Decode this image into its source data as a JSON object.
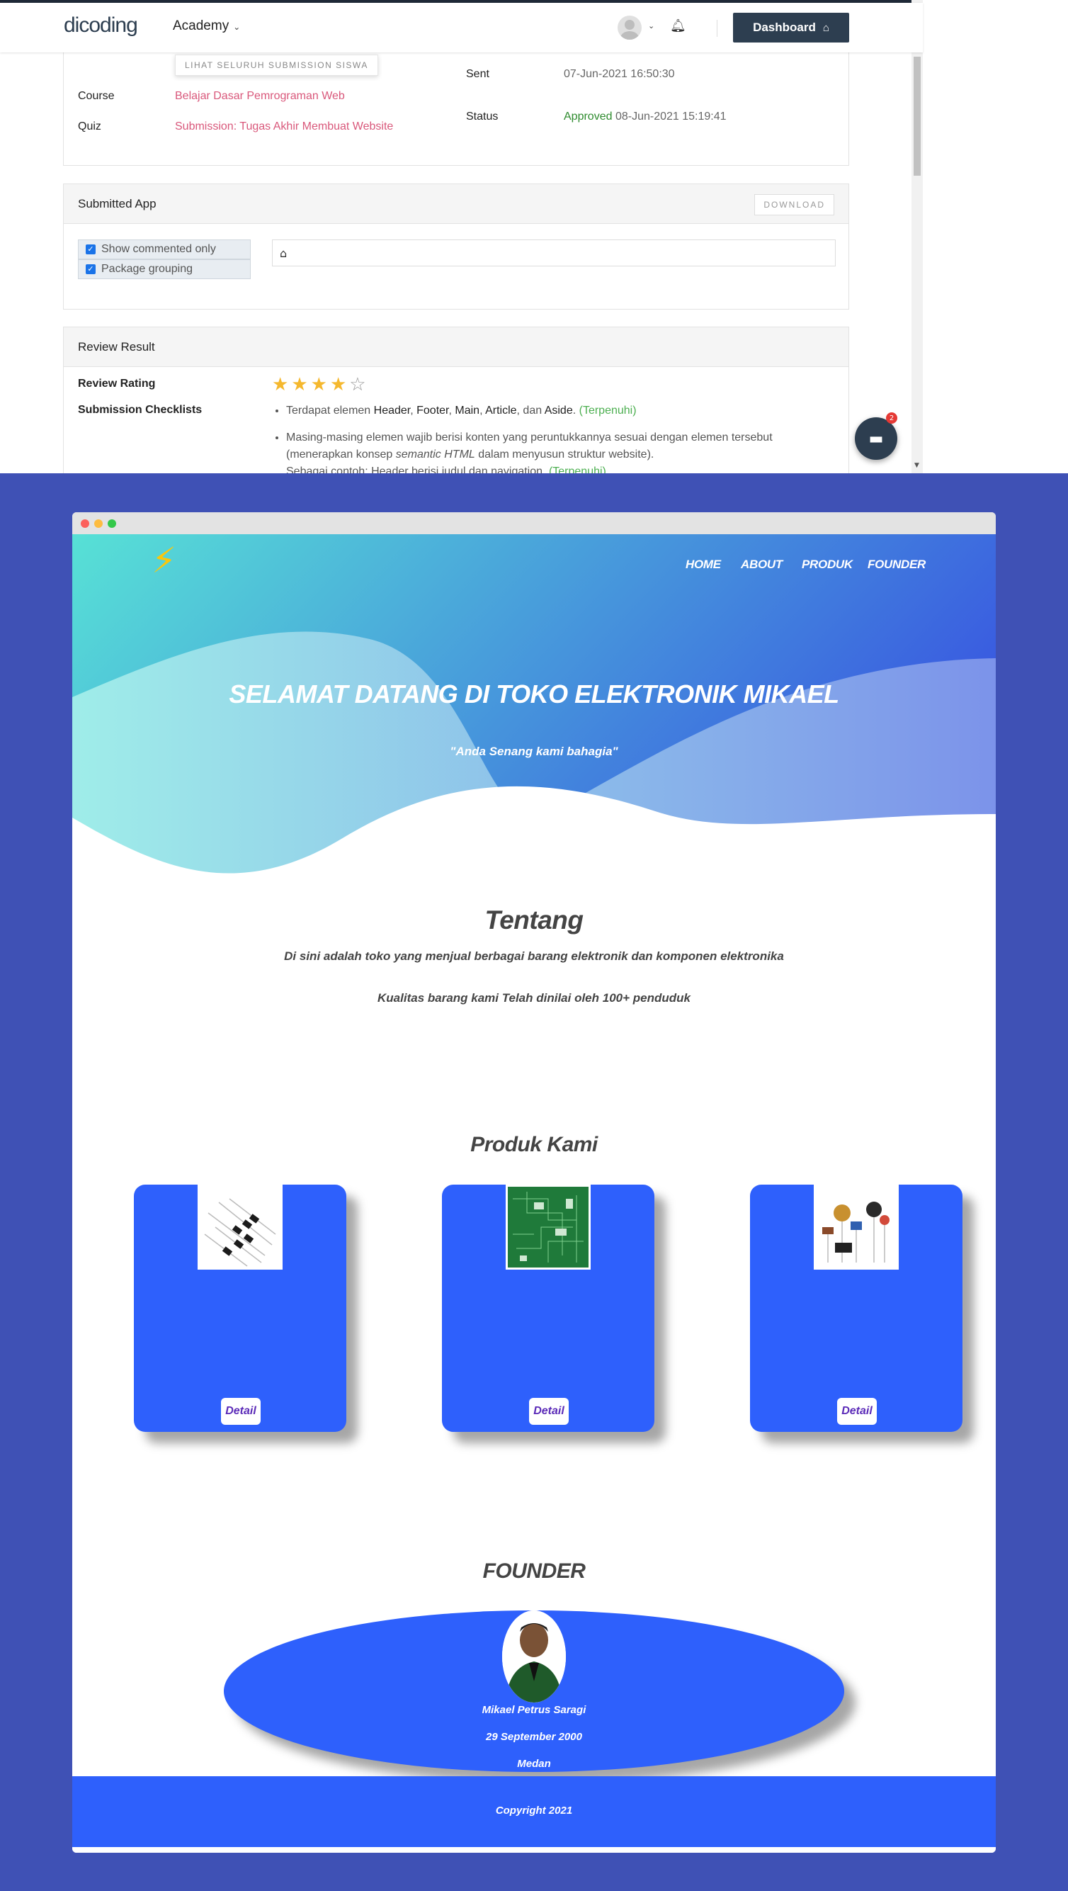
{
  "navbar": {
    "logo": "dicoding",
    "academy": "Academy",
    "dashboard": "Dashboard"
  },
  "submission_info": {
    "lihat_button": "LIHAT SELURUH SUBMISSION SISWA",
    "course_label": "Course",
    "course_value": "Belajar Dasar Pemrograman Web",
    "quiz_label": "Quiz",
    "quiz_value": "Submission: Tugas Akhir Membuat Website",
    "sent_label": "Sent",
    "sent_value": "07-Jun-2021 16:50:30",
    "status_label": "Status",
    "status_value": "Approved",
    "status_date": "08-Jun-2021 15:19:41"
  },
  "submitted_app": {
    "title": "Submitted App",
    "download": "DOWNLOAD",
    "show_commented": "Show commented only",
    "package_grouping": "Package grouping"
  },
  "review": {
    "title": "Review Result",
    "rating_label": "Review Rating",
    "rating": 4,
    "rating_max": 5,
    "checklists_label": "Submission Checklists",
    "item1_prefix": "Terdapat elemen",
    "item1_header": "Header",
    "item1_footer": "Footer",
    "item1_main": "Main",
    "item1_article": "Article",
    "item1_and": "dan",
    "item1_aside": "Aside",
    "item1_status": "(Terpenuhi)",
    "item2_line1": "Masing-masing elemen wajib berisi konten yang peruntukkannya sesuai dengan elemen tersebut",
    "item2_line2_a": "(menerapkan konsep",
    "item2_line2_em": "semantic HTML",
    "item2_line2_b": "dalam menyusun struktur website).",
    "item2_line3": "Sebagai contoh: Header berisi judul dan navigation.",
    "item2_status": "(Terpenuhi)"
  },
  "chat_badge": "2",
  "site": {
    "nav": [
      "HOME",
      "ABOUT",
      "PRODUK",
      "FOUNDER"
    ],
    "hero_title": "SELAMAT DATANG DI TOKO ELEKTRONIK MIKAEL",
    "hero_sub": "\"Anda Senang kami bahagia\"",
    "tentang_title": "Tentang",
    "tentang_p1": "Di sini adalah toko yang menjual berbagai barang elektronik dan komponen elektronika",
    "tentang_p2": "Kualitas barang kami Telah dinilai oleh 100+ penduduk",
    "produk_title": "Produk Kami",
    "detail": "Detail",
    "founder_title": "FOUNDER",
    "founder_name": "Mikael Petrus Saragi",
    "founder_dob": "29 September 2000",
    "founder_city": "Medan",
    "copyright": "Copyright 2021"
  },
  "colors": {
    "page_bg": "#3f51b5",
    "brand_dark": "#2d3e50",
    "card_blue": "#2e60fc",
    "link_pink": "#d9587b",
    "approved_green": "#2e8b2e"
  }
}
